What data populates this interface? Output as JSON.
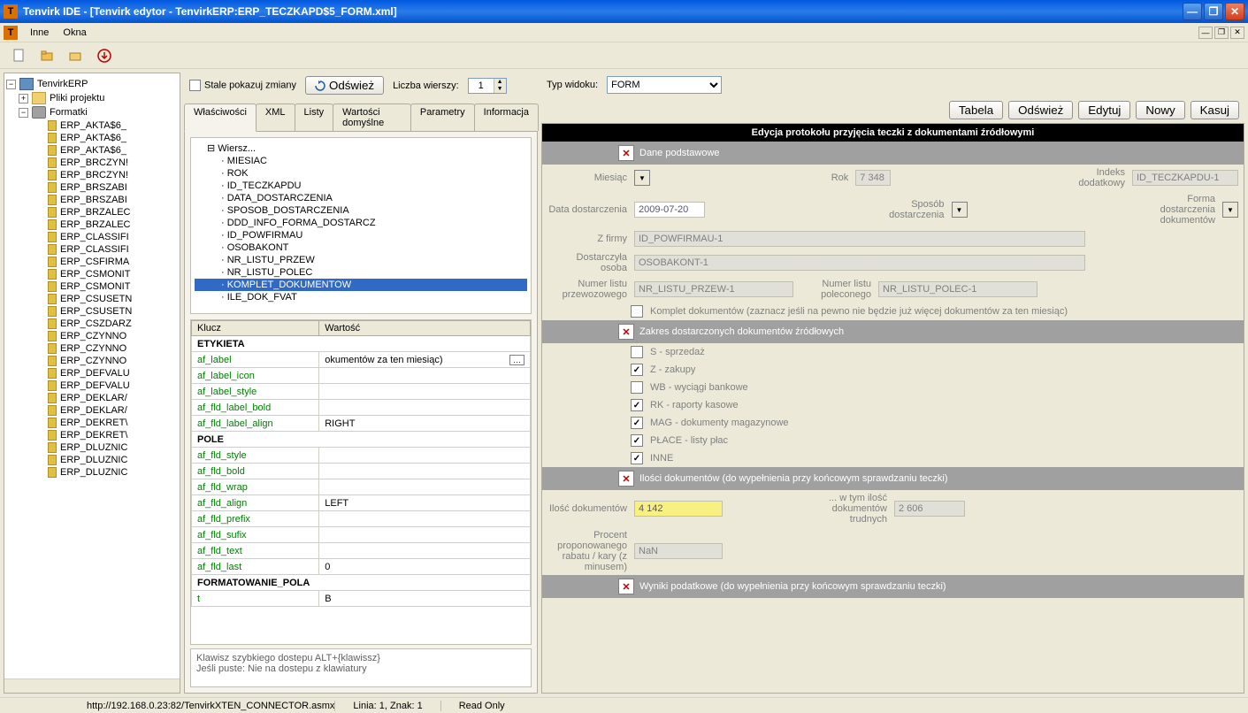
{
  "titlebar": "Tenvirk IDE - [Tenvirk edytor - TenvirkERP:ERP_TECZKAPD$5_FORM.xml]",
  "menu": {
    "inne": "Inne",
    "okna": "Okna"
  },
  "toolbar_mid": {
    "stale_pokazuj": "Stale pokazuj zmiany",
    "odswiez": "Odśwież",
    "liczba_wierszy_lbl": "Liczba wierszy:",
    "liczba_wierszy_val": "1",
    "typ_widoku_lbl": "Typ widoku:",
    "typ_widoku_val": "FORM"
  },
  "tree": {
    "root": "TenvirkERP",
    "folder1": "Pliki projektu",
    "folder2": "Formatki",
    "items": [
      "ERP_AKTA$6_",
      "ERP_AKTA$6_",
      "ERP_AKTA$6_",
      "ERP_BRCZYN!",
      "ERP_BRCZYN!",
      "ERP_BRSZABI",
      "ERP_BRSZABI",
      "ERP_BRZALEC",
      "ERP_BRZALEC",
      "ERP_CLASSIFI",
      "ERP_CLASSIFI",
      "ERP_CSFIRMA",
      "ERP_CSMONIT",
      "ERP_CSMONIT",
      "ERP_CSUSETN",
      "ERP_CSUSETN",
      "ERP_CSZDARZ",
      "ERP_CZYNNO",
      "ERP_CZYNNO",
      "ERP_CZYNNO",
      "ERP_DEFVALU",
      "ERP_DEFVALU",
      "ERP_DEKLAR/",
      "ERP_DEKLAR/",
      "ERP_DEKRET\\",
      "ERP_DEKRET\\",
      "ERP_DLUZNIC",
      "ERP_DLUZNIC",
      "ERP_DLUZNIC"
    ]
  },
  "tabs": {
    "t1": "Właściwości",
    "t2": "XML",
    "t3": "Listy",
    "t4": "Wartości domyślne",
    "t5": "Parametry",
    "t6": "Informacja"
  },
  "treelist": {
    "root": "Wiersz...",
    "items": [
      "MIESIAC",
      "ROK",
      "ID_TECZKAPDU",
      "DATA_DOSTARCZENIA",
      "SPOSOB_DOSTARCZENIA",
      "DDD_INFO_FORMA_DOSTARCZ",
      "ID_POWFIRMAU",
      "OSOBAKONT",
      "NR_LISTU_PRZEW",
      "NR_LISTU_POLEC",
      "KOMPLET_DOKUMENTOW",
      "ILE_DOK_FVAT"
    ],
    "selected": "KOMPLET_DOKUMENTOW"
  },
  "prop_headers": {
    "k": "Klucz",
    "v": "Wartość"
  },
  "props": [
    {
      "section": "ETYKIETA"
    },
    {
      "k": "af_label",
      "v": "okumentów za ten miesiąc)",
      "ellips": true
    },
    {
      "k": "af_label_icon",
      "v": ""
    },
    {
      "k": "af_label_style",
      "v": ""
    },
    {
      "k": "af_fld_label_bold",
      "v": ""
    },
    {
      "k": "af_fld_label_align",
      "v": "RIGHT"
    },
    {
      "section": "POLE"
    },
    {
      "k": "af_fld_style",
      "v": ""
    },
    {
      "k": "af_fld_bold",
      "v": ""
    },
    {
      "k": "af_fld_wrap",
      "v": ""
    },
    {
      "k": "af_fld_align",
      "v": "LEFT"
    },
    {
      "k": "af_fld_prefix",
      "v": ""
    },
    {
      "k": "af_fld_sufix",
      "v": ""
    },
    {
      "k": "af_fld_text",
      "v": ""
    },
    {
      "k": "af_fld_last",
      "v": "0"
    },
    {
      "section": "FORMATOWANIE_POLA"
    },
    {
      "k": "t",
      "v": "B"
    }
  ],
  "helpbox": {
    "l1": "Klawisz szybkiego dostepu ALT+{klawissz}",
    "l2": "Jeśli puste: Nie na dostepu z klawiatury"
  },
  "rightbtns": {
    "tabela": "Tabela",
    "odswiez": "Odśwież",
    "edytuj": "Edytuj",
    "nowy": "Nowy",
    "kasuj": "Kasuj"
  },
  "form": {
    "title": "Edycja protokołu przyjęcia teczki z dokumentami źródłowymi",
    "sec1": "Dane podstawowe",
    "miesiac_lbl": "Miesiąc",
    "rok_lbl": "Rok",
    "rok_val": "7 348",
    "indeks_lbl": "Indeks dodatkowy",
    "indeks_val": "ID_TECZKAPDU-1",
    "data_lbl": "Data dostarczenia",
    "data_val": "2009-07-20",
    "sposob_lbl": "Sposób dostarczenia",
    "forma_lbl": "Forma dostarczenia dokumentów",
    "zfirmy_lbl": "Z firmy",
    "zfirmy_val": "ID_POWFIRMAU-1",
    "dosob_lbl": "Dostarczyła osoba",
    "dosob_val": "OSOBAKONT-1",
    "nrprzew_lbl": "Numer listu przewozowego",
    "nrprzew_val": "NR_LISTU_PRZEW-1",
    "nrpolec_lbl": "Numer listu poleconego",
    "nrpolec_val": "NR_LISTU_POLEC-1",
    "komplet_lbl": "Komplet dokumentów (zaznacz jeśli na pewno nie będzie już więcej dokumentów za ten miesiąc)",
    "sec2": "Zakres dostarczonych dokumentów źródłowych",
    "chk_s": "S - sprzedaż",
    "chk_z": "Z - zakupy",
    "chk_wb": "WB - wyciągi bankowe",
    "chk_rk": "RK - raporty kasowe",
    "chk_mag": "MAG - dokumenty magazynowe",
    "chk_place": "PŁACE - listy płac",
    "chk_inne": "INNE",
    "sec3": "Ilości dokumentów (do wypełnienia przy końcowym sprawdzaniu teczki)",
    "ilosc_lbl": "Ilość dokumentów",
    "ilosc_val": "4 142",
    "trudne_lbl": "... w tym ilość dokumentów trudnych",
    "trudne_val": "2 606",
    "procent_lbl": "Procent proponowanego rabatu / kary (z minusem)",
    "procent_val": "NaN",
    "sec4": "Wyniki podatkowe (do wypełnienia przy końcowym sprawdzaniu teczki)"
  },
  "status": {
    "linia": "Linia: 1, Znak: 1",
    "ro": "Read Only",
    "url": "http://192.168.0.23:82/TenvirkXTEN_CONNECTOR.asmx"
  }
}
